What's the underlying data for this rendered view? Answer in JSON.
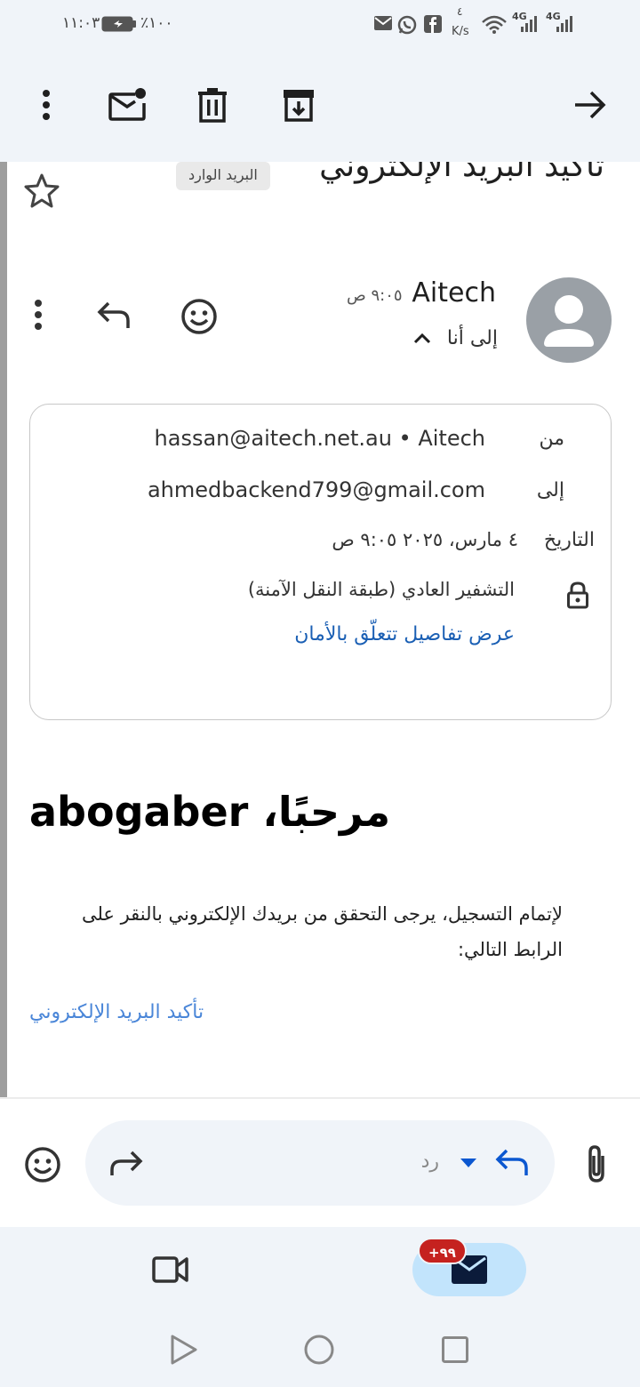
{
  "status_bar": {
    "time": "١١:٠٣",
    "battery": "٪١٠٠",
    "net_speed_value": "٤",
    "net_speed_unit": "K/s",
    "net1": "4G",
    "net2": "4G"
  },
  "toolbar": {
    "more_icon": "more-vertical-icon",
    "unread_icon": "mark-unread-icon",
    "delete_icon": "trash-icon",
    "archive_icon": "archive-icon",
    "back_icon": "arrow-icon"
  },
  "email": {
    "subject": "تاكيد البريد الإلكتروني",
    "label_chip": "البريد الوارد",
    "sender_name": "Aitech",
    "time": "٩:٠٥ ص",
    "to_me": "إلى أنا",
    "details": {
      "from_label": "من",
      "from_value": "hassan@aitech.net.au • Aitech",
      "to_label": "إلى",
      "to_value": "ahmedbackend799@gmail.com",
      "date_label": "التاريخ",
      "date_value": "٤ مارس، ٢٠٢٥ ٩:٠٥ ص",
      "security_value": "التشفير العادي (طبقة النقل الآمنة)",
      "security_link": "عرض تفاصيل تتعلّق بالأمان"
    },
    "greeting": "مرحبًا، abogaber",
    "body_text": "لإتمام التسجيل، يرجى التحقق من بريدك الإلكتروني بالنقر على الرابط التالي:",
    "confirm_link": "تأكيد البريد الإلكتروني"
  },
  "reply_bar": {
    "reply_label": "رد"
  },
  "bottom_nav": {
    "badge": "+٩٩"
  },
  "colors": {
    "accent": "#0b57d0",
    "link": "#1a5fb4",
    "badge": "#c5221f",
    "surface": "#f0f4f9"
  }
}
